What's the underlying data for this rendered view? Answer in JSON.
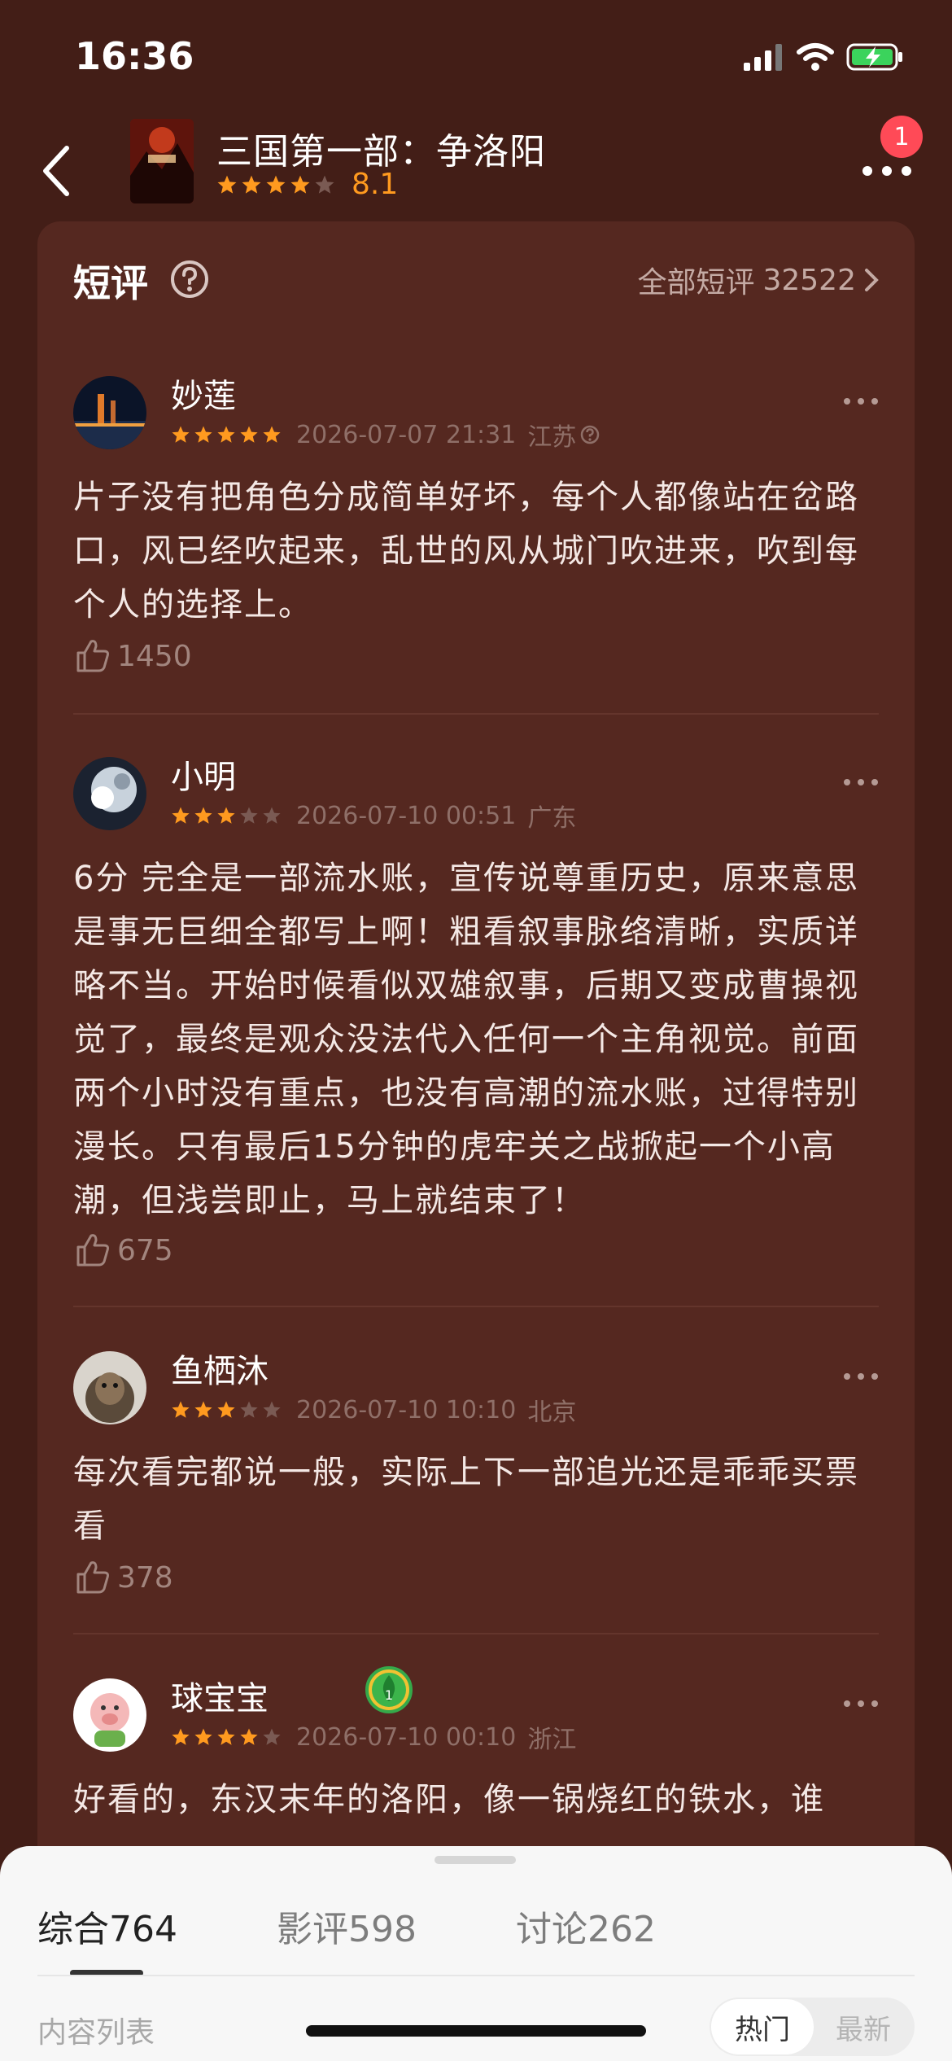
{
  "status_bar": {
    "time": "16:36"
  },
  "header": {
    "movie_title": "三国第一部：争洛阳",
    "rating_score": "8.1",
    "rating_stars": 4,
    "notification_count": "1"
  },
  "section": {
    "title": "短评",
    "all_link_label": "全部短评",
    "all_count": "32522"
  },
  "reviews": [
    {
      "name": "妙莲",
      "stars": 5,
      "date": "2026-07-07 21:31",
      "location": "江苏",
      "text": "片子没有把角色分成简单好坏，每个人都像站在岔路口，风已经吹起来，乱世的风从城门吹进来，吹到每个人的选择上。",
      "likes": "1450"
    },
    {
      "name": "小明",
      "stars": 3,
      "date": "2026-07-10 00:51",
      "location": "广东",
      "text": "6分  完全是一部流水账，宣传说尊重历史，原来意思是事无巨细全都写上啊！粗看叙事脉络清晰，实质详略不当。开始时候看似双雄叙事，后期又变成曹操视觉了，最终是观众没法代入任何一个主角视觉。前面两个小时没有重点，也没有高潮的流水账，过得特别漫长。只有最后15分钟的虎牢关之战掀起一个小高潮，但浅尝即止，马上就结束了！",
      "likes": "675"
    },
    {
      "name": "鱼栖沐",
      "stars": 3,
      "date": "2026-07-10 10:10",
      "location": "北京",
      "text": "每次看完都说一般，实际上下一部追光还是乖乖买票看",
      "likes": "378"
    },
    {
      "name": "球宝宝",
      "stars": 4,
      "date": "2026-07-10 00:10",
      "location": "浙江",
      "level_badge": "1",
      "text": "好看的，东汉末年的洛阳，像一锅烧红的铁水，谁",
      "likes": ""
    }
  ],
  "bottom_sheet": {
    "tabs": [
      {
        "label": "综合",
        "count": "764"
      },
      {
        "label": "影评",
        "count": "598"
      },
      {
        "label": "讨论",
        "count": "262"
      }
    ],
    "list_label": "内容列表",
    "sort_hot": "热门",
    "sort_new": "最新"
  },
  "colors": {
    "background": "#431e17",
    "card": "#552820",
    "star": "#ff9a1f",
    "badge": "#ff4a57"
  }
}
